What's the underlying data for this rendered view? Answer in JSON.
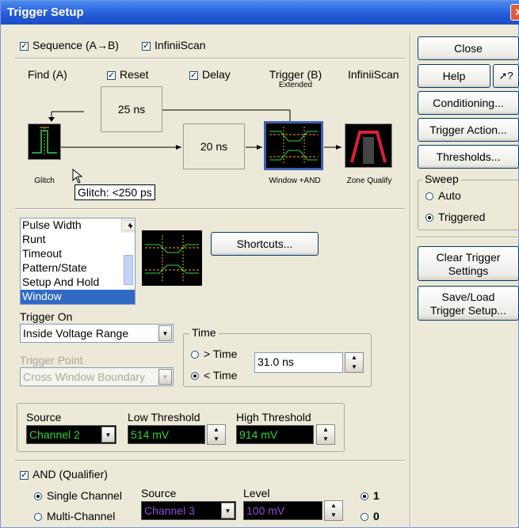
{
  "title": "Trigger Setup",
  "top_checks": {
    "sequence": "Sequence (A→B)",
    "infiniiscan": "InfiniiScan"
  },
  "headers": {
    "find": "Find (A)",
    "reset": "Reset",
    "delay": "Delay",
    "trigger": "Trigger (B)",
    "trigger_sub": "Extended",
    "infiniiscan": "InfiniiScan"
  },
  "diagram": {
    "reset_time": "25 ns",
    "delay_time": "20 ns",
    "glitch_caption": "Glitch",
    "window_caption": "Window +AND",
    "zone_caption": "Zone Qualify",
    "tooltip": "Glitch: <250 ps"
  },
  "trigger_list": {
    "items": [
      "Pulse Width",
      "Runt",
      "Timeout",
      "Pattern/State",
      "Setup And Hold",
      "Window"
    ],
    "selected": "Window"
  },
  "shortcuts": "Shortcuts...",
  "trigger_on": {
    "label": "Trigger On",
    "value": "Inside Voltage Range"
  },
  "trigger_point": {
    "label": "Trigger Point",
    "value": "Cross Window Boundary"
  },
  "time": {
    "group": "Time",
    "gt": "> Time",
    "lt": "< Time",
    "selected": "< Time",
    "value": "31.0 ns"
  },
  "source_row": {
    "source_label": "Source",
    "source": "Channel 2",
    "low_label": "Low Threshold",
    "low": "514 mV",
    "high_label": "High Threshold",
    "high": "914 mV"
  },
  "and_qualifier": {
    "label": "AND (Qualifier)",
    "single": "Single Channel",
    "multi": "Multi-Channel",
    "selected": "Single Channel",
    "source_label": "Source",
    "source": "Channel 3",
    "level_label": "Level",
    "level": "100 mV",
    "one": "1",
    "zero": "0",
    "selected_logic": "1"
  },
  "side": {
    "close": "Close",
    "help": "Help",
    "help_icon": "pointer-question",
    "conditioning": "Conditioning...",
    "trigger_action": "Trigger Action...",
    "thresholds": "Thresholds...",
    "sweep": "Sweep",
    "auto": "Auto",
    "triggered": "Triggered",
    "sweep_selected": "Triggered",
    "clear_l1": "Clear Trigger",
    "clear_l2": "Settings",
    "save_l1": "Save/Load",
    "save_l2": "Trigger Setup..."
  },
  "colors": {
    "titlebar": "#2359d8",
    "list_selected": "#316ac5",
    "trace_green": "#2fd53a",
    "trace_orange": "#f5a623",
    "trace_purple": "#8d4ed8",
    "zone_red": "#d8203c"
  }
}
